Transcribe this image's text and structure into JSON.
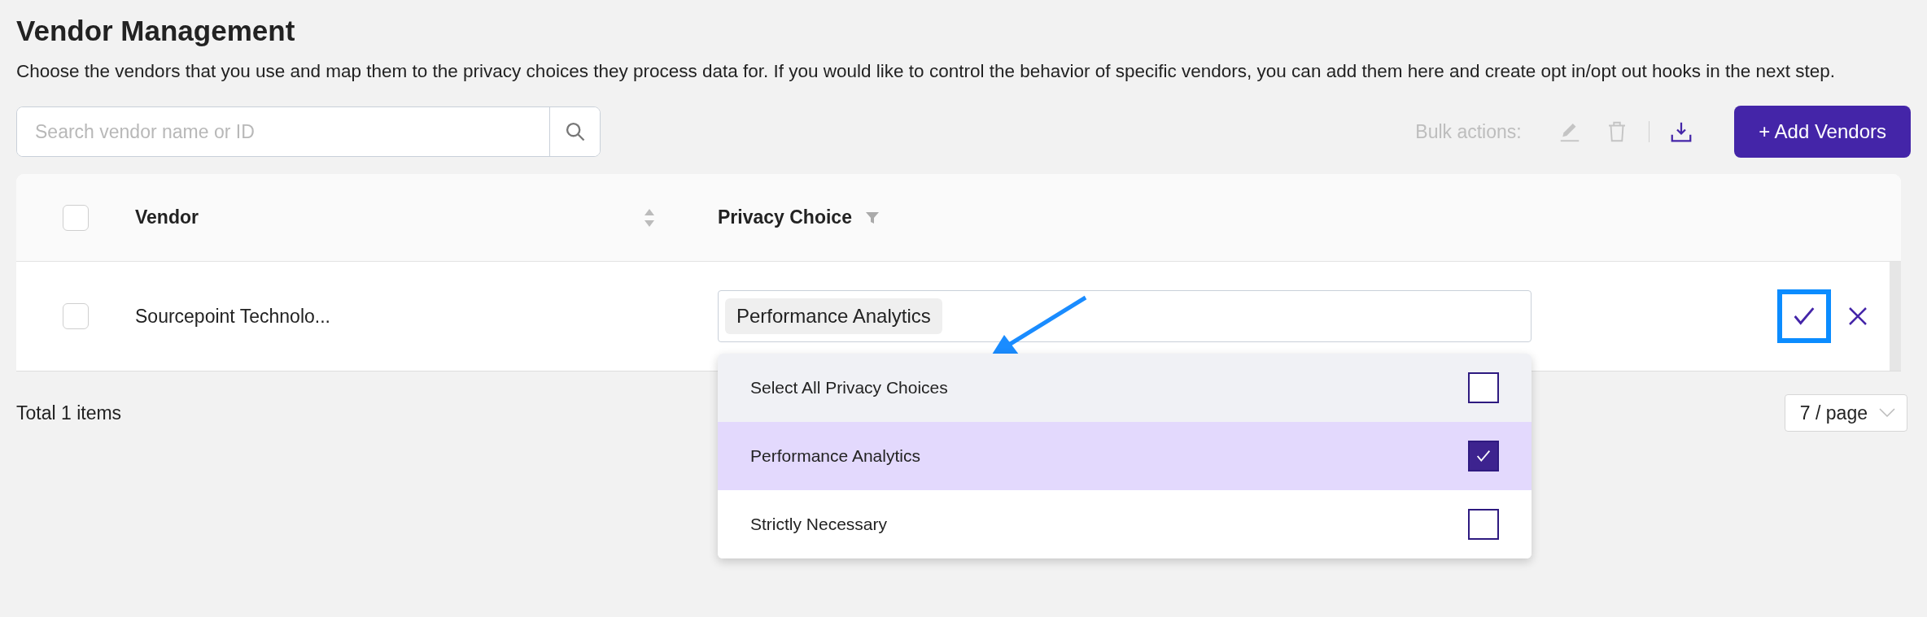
{
  "page": {
    "title": "Vendor Management",
    "description": "Choose the vendors that you use and map them to the privacy choices they process data for. If you would like to control the behavior of specific vendors, you can add them here and create opt in/opt out hooks in the next step."
  },
  "search": {
    "placeholder": "Search vendor name or ID"
  },
  "toolbar": {
    "bulk_label": "Bulk actions:",
    "add_button": "+ Add Vendors"
  },
  "table": {
    "header_checked": false,
    "columns": [
      "Vendor",
      "Privacy Choice"
    ],
    "rows": [
      {
        "checked": false,
        "vendor": "Sourcepoint Technolo...",
        "tags": [
          "Performance Analytics"
        ]
      }
    ]
  },
  "dropdown": {
    "options": [
      {
        "kind": "select_all",
        "label": "Select All Privacy Choices",
        "selected": false,
        "checked": false
      },
      {
        "kind": "option",
        "label": "Performance Analytics",
        "selected": true,
        "checked": true
      },
      {
        "kind": "option",
        "label": "Strictly Necessary",
        "selected": false,
        "checked": false
      }
    ]
  },
  "footer": {
    "total": "Total 1 items",
    "page_size": "7 / page"
  }
}
